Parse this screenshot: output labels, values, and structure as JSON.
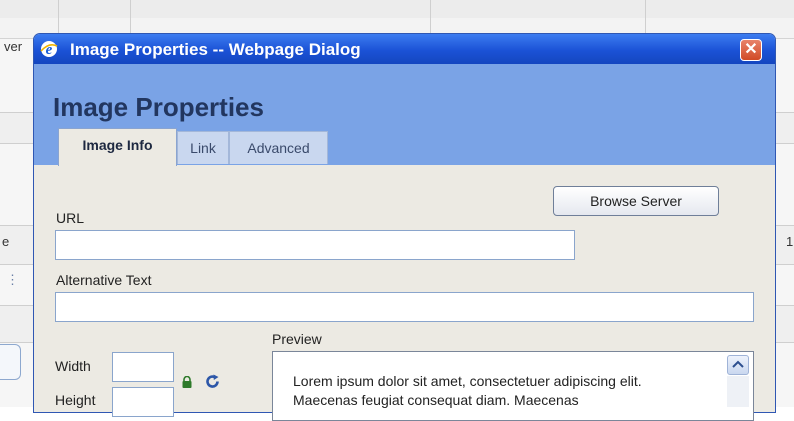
{
  "background": {
    "edge_label_top": "ver",
    "edge_label_mid": "e",
    "right_label": "1"
  },
  "dialog": {
    "title": "Image Properties -- Webpage Dialog",
    "close_glyph": "✕",
    "heading": "Image Properties",
    "tabs": [
      {
        "label": "Image Info",
        "active": true
      },
      {
        "label": "Link",
        "active": false
      },
      {
        "label": "Advanced",
        "active": false
      }
    ],
    "url": {
      "label": "URL",
      "value": ""
    },
    "browse_button": "Browse Server",
    "alt_text": {
      "label": "Alternative Text",
      "value": ""
    },
    "width": {
      "label": "Width",
      "value": ""
    },
    "height": {
      "label": "Height",
      "value": ""
    },
    "preview": {
      "label": "Preview",
      "text": "Lorem ipsum dolor sit amet, consectetuer adipiscing elit. Maecenas feugiat consequat diam. Maecenas"
    }
  },
  "icons": {
    "browser": "ie-icon",
    "lock": "lock-icon",
    "reset": "reset-size-icon"
  },
  "colors": {
    "titlebar": "#1b52d6",
    "header": "#7aa3e6",
    "body": "#eceae3",
    "close": "#d14a26"
  }
}
